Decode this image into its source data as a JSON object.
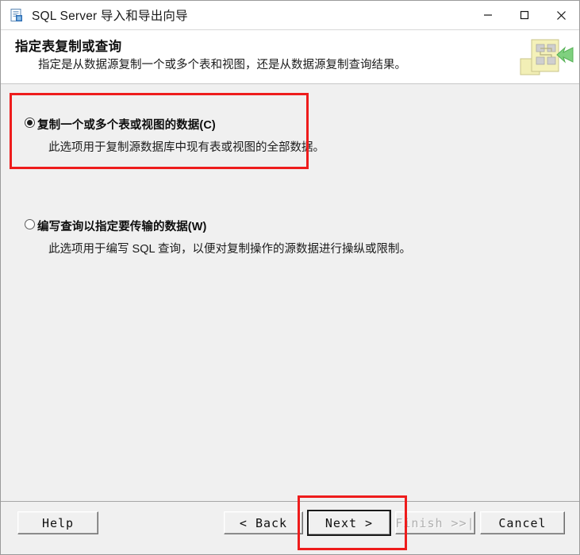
{
  "window": {
    "title": "SQL Server 导入和导出向导",
    "icon": "wizard-document-icon",
    "controls": {
      "minimize": "minimize-icon",
      "maximize": "maximize-icon",
      "close": "close-icon"
    }
  },
  "header": {
    "title": "指定表复制或查询",
    "subtitle": "指定是从数据源复制一个或多个表和视图，还是从数据源复制查询结果。",
    "icon": "data-flow-icon"
  },
  "options": [
    {
      "label": "复制一个或多个表或视图的数据(C)",
      "description": "此选项用于复制源数据库中现有表或视图的全部数据。",
      "selected": true
    },
    {
      "label": "编写查询以指定要传输的数据(W)",
      "description": "此选项用于编写 SQL 查询，以便对复制操作的源数据进行操纵或限制。",
      "selected": false
    }
  ],
  "footer": {
    "help": "Help",
    "back": "< Back",
    "next": "Next >",
    "finish": "Finish >>|",
    "cancel": "Cancel"
  },
  "annotations": {
    "accent_color": "#ee1c1c",
    "option_box": "highlight-first-option",
    "next_box": "highlight-next-button"
  }
}
